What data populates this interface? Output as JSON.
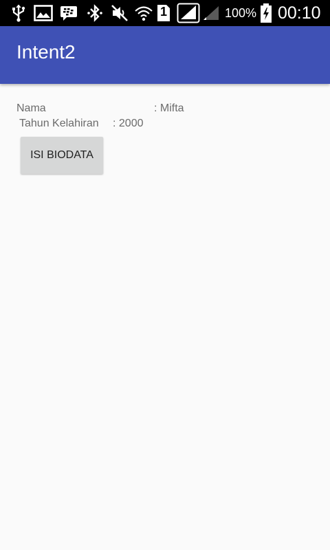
{
  "status_bar": {
    "battery_percent_text": "100%",
    "clock": "00:10",
    "sim_number": "1",
    "icons": [
      "usb-icon",
      "image-icon",
      "bbm-icon",
      "bluetooth-icon",
      "mute-icon",
      "wifi-icon",
      "sim-icon",
      "signal-icon",
      "battery-charging-icon"
    ]
  },
  "app_bar": {
    "title": "Intent2",
    "color": "#3f51b5"
  },
  "content": {
    "nama_label": "Nama",
    "nama_value": ": Mifta",
    "tahun_label": "Tahun Kelahiran",
    "tahun_value": ": 2000",
    "button_label": "ISI BIODATA"
  }
}
